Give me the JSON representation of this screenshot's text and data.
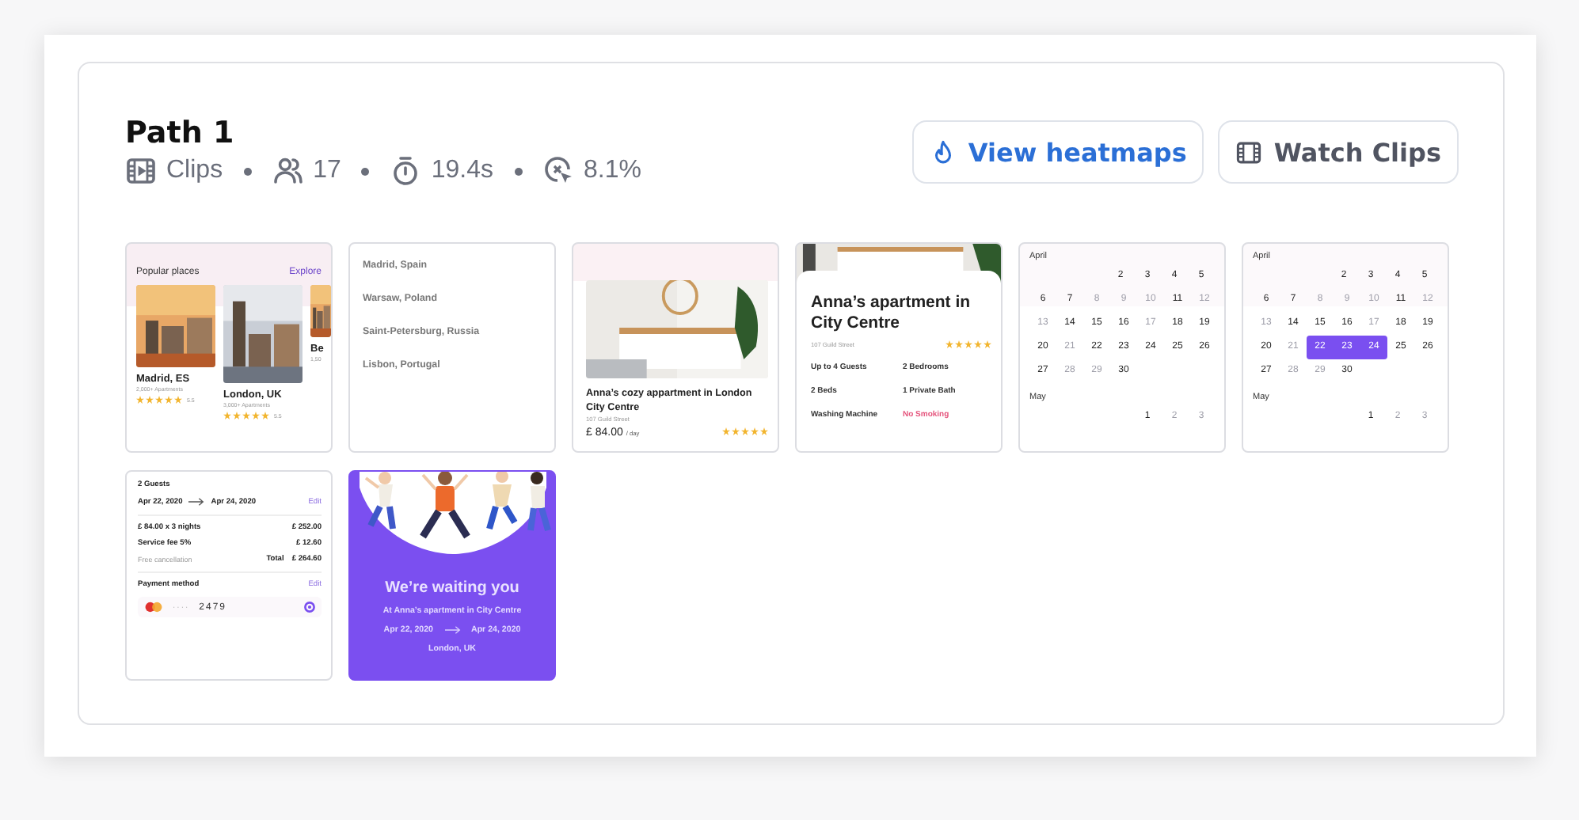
{
  "path": {
    "title": "Path 1",
    "stats": [
      {
        "kind": "clips",
        "text": "Clips"
      },
      {
        "kind": "users",
        "text": "17"
      },
      {
        "kind": "timer",
        "text": "19.4s"
      },
      {
        "kind": "rate",
        "text": "8.1%"
      }
    ]
  },
  "buttons": [
    {
      "kind": "heatmap",
      "label": "View heatmaps"
    },
    {
      "kind": "clips",
      "label": "Watch Clips"
    }
  ],
  "screens": [
    {
      "kind": "places",
      "heading": "Popular places",
      "link": "Explore",
      "places": [
        {
          "name": "Madrid, ES",
          "sub": "2,000+ Apartments",
          "rating": "5.5",
          "stars": 5
        },
        {
          "name": "London, UK",
          "sub": "3,000+ Apartments",
          "rating": "5.5",
          "stars": 5
        },
        {
          "name": "Be",
          "sub": "1,50"
        }
      ]
    },
    {
      "kind": "list",
      "items": [
        "Madrid, Spain",
        "Warsaw, Poland",
        "Saint-Petersburg, Russia",
        "Lisbon, Portugal"
      ]
    },
    {
      "kind": "listing",
      "title": "Anna’s cozy appartment in London City Centre",
      "address": "107 Guild Street",
      "price": "£ 84.00",
      "unit": "/ day",
      "stars": 5
    },
    {
      "kind": "detail",
      "title": "Anna’s apartment in City Centre",
      "address": "107 Guild Street",
      "stars": 5,
      "features": [
        {
          "text": "Up to 4 Guests",
          "warning": false
        },
        {
          "text": "2 Bedrooms",
          "warning": false
        },
        {
          "text": "2 Beds",
          "warning": false
        },
        {
          "text": "1 Private Bath",
          "warning": false
        },
        {
          "text": "Washing Machine",
          "warning": false
        },
        {
          "text": "No Smoking",
          "warning": true
        }
      ]
    },
    {
      "kind": "calendar",
      "months": [
        {
          "name": "April",
          "weeks": [
            {
              "kind": "head",
              "days": [
                {
                  "text": "2",
                  "disabled": false,
                  "selected": false
                },
                {
                  "text": "3",
                  "disabled": false,
                  "selected": false
                },
                {
                  "text": "4",
                  "disabled": false,
                  "selected": false
                },
                {
                  "text": "5",
                  "disabled": false,
                  "selected": false
                }
              ]
            },
            {
              "kind": "full",
              "days": [
                {
                  "text": "6",
                  "disabled": false,
                  "selected": false
                },
                {
                  "text": "7",
                  "disabled": false,
                  "selected": false
                },
                {
                  "text": "8",
                  "disabled": true,
                  "selected": false
                },
                {
                  "text": "9",
                  "disabled": true,
                  "selected": false
                },
                {
                  "text": "10",
                  "disabled": true,
                  "selected": false
                },
                {
                  "text": "11",
                  "disabled": false,
                  "selected": false
                },
                {
                  "text": "12",
                  "disabled": true,
                  "selected": false
                }
              ]
            },
            {
              "kind": "full",
              "days": [
                {
                  "text": "13",
                  "disabled": true,
                  "selected": false
                },
                {
                  "text": "14",
                  "disabled": false,
                  "selected": false
                },
                {
                  "text": "15",
                  "disabled": false,
                  "selected": false
                },
                {
                  "text": "16",
                  "disabled": false,
                  "selected": false
                },
                {
                  "text": "17",
                  "disabled": true,
                  "selected": false
                },
                {
                  "text": "18",
                  "disabled": false,
                  "selected": false
                },
                {
                  "text": "19",
                  "disabled": false,
                  "selected": false
                }
              ]
            },
            {
              "kind": "full",
              "days": [
                {
                  "text": "20",
                  "disabled": false,
                  "selected": false
                },
                {
                  "text": "21",
                  "disabled": true,
                  "selected": false
                },
                {
                  "text": "22",
                  "disabled": false,
                  "selected": false
                },
                {
                  "text": "23",
                  "disabled": false,
                  "selected": false
                },
                {
                  "text": "24",
                  "disabled": false,
                  "selected": false
                },
                {
                  "text": "25",
                  "disabled": false,
                  "selected": false
                },
                {
                  "text": "26",
                  "disabled": false,
                  "selected": false
                }
              ]
            },
            {
              "kind": "tail",
              "days": [
                {
                  "text": "27",
                  "disabled": false,
                  "selected": false
                },
                {
                  "text": "28",
                  "disabled": true,
                  "selected": false
                },
                {
                  "text": "29",
                  "disabled": true,
                  "selected": false
                },
                {
                  "text": "30",
                  "disabled": false,
                  "selected": false
                }
              ]
            }
          ]
        },
        {
          "name": "May",
          "weeks": [
            {
              "kind": "head",
              "days": [
                {
                  "text": "1",
                  "disabled": false,
                  "selected": false
                },
                {
                  "text": "2",
                  "disabled": true,
                  "selected": false
                },
                {
                  "text": "3",
                  "disabled": true,
                  "selected": false
                }
              ]
            }
          ]
        }
      ]
    },
    {
      "kind": "calendar",
      "months": [
        {
          "name": "April",
          "weeks": [
            {
              "kind": "head",
              "days": [
                {
                  "text": "2",
                  "disabled": false,
                  "selected": false
                },
                {
                  "text": "3",
                  "disabled": false,
                  "selected": false
                },
                {
                  "text": "4",
                  "disabled": false,
                  "selected": false
                },
                {
                  "text": "5",
                  "disabled": false,
                  "selected": false
                }
              ]
            },
            {
              "kind": "full",
              "days": [
                {
                  "text": "6",
                  "disabled": false,
                  "selected": false
                },
                {
                  "text": "7",
                  "disabled": false,
                  "selected": false
                },
                {
                  "text": "8",
                  "disabled": true,
                  "selected": false
                },
                {
                  "text": "9",
                  "disabled": true,
                  "selected": false
                },
                {
                  "text": "10",
                  "disabled": true,
                  "selected": false
                },
                {
                  "text": "11",
                  "disabled": false,
                  "selected": false
                },
                {
                  "text": "12",
                  "disabled": true,
                  "selected": false
                }
              ]
            },
            {
              "kind": "full",
              "days": [
                {
                  "text": "13",
                  "disabled": true,
                  "selected": false
                },
                {
                  "text": "14",
                  "disabled": false,
                  "selected": false
                },
                {
                  "text": "15",
                  "disabled": false,
                  "selected": false
                },
                {
                  "text": "16",
                  "disabled": false,
                  "selected": false
                },
                {
                  "text": "17",
                  "disabled": true,
                  "selected": false
                },
                {
                  "text": "18",
                  "disabled": false,
                  "selected": false
                },
                {
                  "text": "19",
                  "disabled": false,
                  "selected": false
                }
              ]
            },
            {
              "kind": "full",
              "days": [
                {
                  "text": "20",
                  "disabled": false,
                  "selected": false
                },
                {
                  "text": "21",
                  "disabled": true,
                  "selected": false
                },
                {
                  "text": "22",
                  "disabled": false,
                  "selected": true
                },
                {
                  "text": "23",
                  "disabled": false,
                  "selected": true
                },
                {
                  "text": "24",
                  "disabled": false,
                  "selected": true
                },
                {
                  "text": "25",
                  "disabled": false,
                  "selected": false
                },
                {
                  "text": "26",
                  "disabled": false,
                  "selected": false
                }
              ]
            },
            {
              "kind": "tail",
              "days": [
                {
                  "text": "27",
                  "disabled": false,
                  "selected": false
                },
                {
                  "text": "28",
                  "disabled": true,
                  "selected": false
                },
                {
                  "text": "29",
                  "disabled": true,
                  "selected": false
                },
                {
                  "text": "30",
                  "disabled": false,
                  "selected": false
                }
              ]
            }
          ]
        },
        {
          "name": "May",
          "weeks": [
            {
              "kind": "head",
              "days": [
                {
                  "text": "1",
                  "disabled": false,
                  "selected": false
                },
                {
                  "text": "2",
                  "disabled": true,
                  "selected": false
                },
                {
                  "text": "3",
                  "disabled": true,
                  "selected": false
                }
              ]
            }
          ]
        }
      ]
    },
    {
      "kind": "booking",
      "guests": "2 Guests",
      "from": "Apr 22, 2020",
      "to": "Apr 24, 2020",
      "edit": "Edit",
      "lines": [
        {
          "label": "£ 84.00 x 3 nights",
          "value": "£ 252.00"
        },
        {
          "label": "Service fee 5%",
          "value": "£ 12.60"
        }
      ],
      "note": "Free cancellation",
      "total_label": "Total",
      "total": "£ 264.60",
      "payment": "Payment method",
      "payment_edit": "Edit",
      "card_mask": "····",
      "card_number": "2479"
    },
    {
      "kind": "confirmation",
      "title": "We’re waiting you",
      "place": "At Anna’s apartment in City Centre",
      "from": "Apr 22, 2020",
      "to": "Apr 24, 2020",
      "city": "London, UK"
    }
  ]
}
